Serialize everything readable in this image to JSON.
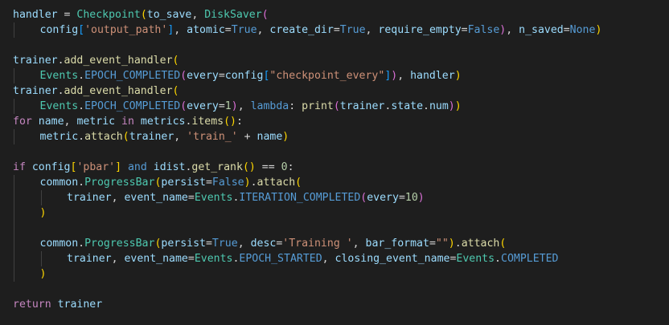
{
  "colors": {
    "background": "#1e1e1e",
    "variable": "#9cdcfe",
    "text": "#d4d4d4",
    "function": "#dcdcaa",
    "class": "#4ec9b0",
    "keyword": "#569cd6",
    "control": "#c586c0",
    "string": "#ce9178",
    "number": "#b5cea8",
    "bracket1": "#ffd700",
    "bracket2": "#da70d6",
    "bracket3": "#179fff",
    "indent_guide": "#404040"
  },
  "code_lines": [
    {
      "indent": 0,
      "tokens": [
        {
          "t": "handler",
          "c": "variable"
        },
        {
          "t": " = ",
          "c": "text"
        },
        {
          "t": "Checkpoint",
          "c": "class"
        },
        {
          "t": "(",
          "c": "bracket1"
        },
        {
          "t": "to_save",
          "c": "variable"
        },
        {
          "t": ", ",
          "c": "text"
        },
        {
          "t": "DiskSaver",
          "c": "class"
        },
        {
          "t": "(",
          "c": "bracket2"
        }
      ]
    },
    {
      "indent": 1,
      "tokens": [
        {
          "t": "config",
          "c": "variable"
        },
        {
          "t": "[",
          "c": "bracket3"
        },
        {
          "t": "'output_path'",
          "c": "string"
        },
        {
          "t": "]",
          "c": "bracket3"
        },
        {
          "t": ", ",
          "c": "text"
        },
        {
          "t": "atomic",
          "c": "variable"
        },
        {
          "t": "=",
          "c": "text"
        },
        {
          "t": "True",
          "c": "keyword"
        },
        {
          "t": ", ",
          "c": "text"
        },
        {
          "t": "create_dir",
          "c": "variable"
        },
        {
          "t": "=",
          "c": "text"
        },
        {
          "t": "True",
          "c": "keyword"
        },
        {
          "t": ", ",
          "c": "text"
        },
        {
          "t": "require_empty",
          "c": "variable"
        },
        {
          "t": "=",
          "c": "text"
        },
        {
          "t": "False",
          "c": "keyword"
        },
        {
          "t": ")",
          "c": "bracket2"
        },
        {
          "t": ", ",
          "c": "text"
        },
        {
          "t": "n_saved",
          "c": "variable"
        },
        {
          "t": "=",
          "c": "text"
        },
        {
          "t": "None",
          "c": "keyword"
        },
        {
          "t": ")",
          "c": "bracket1"
        }
      ]
    },
    {
      "indent": 0,
      "tokens": []
    },
    {
      "indent": 0,
      "tokens": [
        {
          "t": "trainer",
          "c": "variable"
        },
        {
          "t": ".",
          "c": "text"
        },
        {
          "t": "add_event_handler",
          "c": "function"
        },
        {
          "t": "(",
          "c": "bracket1"
        }
      ]
    },
    {
      "indent": 1,
      "tokens": [
        {
          "t": "Events",
          "c": "class"
        },
        {
          "t": ".",
          "c": "text"
        },
        {
          "t": "EPOCH_COMPLETED",
          "c": "keyword"
        },
        {
          "t": "(",
          "c": "bracket2"
        },
        {
          "t": "every",
          "c": "variable"
        },
        {
          "t": "=",
          "c": "text"
        },
        {
          "t": "config",
          "c": "variable"
        },
        {
          "t": "[",
          "c": "bracket3"
        },
        {
          "t": "\"checkpoint_every\"",
          "c": "string"
        },
        {
          "t": "]",
          "c": "bracket3"
        },
        {
          "t": ")",
          "c": "bracket2"
        },
        {
          "t": ", ",
          "c": "text"
        },
        {
          "t": "handler",
          "c": "variable"
        },
        {
          "t": ")",
          "c": "bracket1"
        }
      ]
    },
    {
      "indent": 0,
      "tokens": [
        {
          "t": "trainer",
          "c": "variable"
        },
        {
          "t": ".",
          "c": "text"
        },
        {
          "t": "add_event_handler",
          "c": "function"
        },
        {
          "t": "(",
          "c": "bracket1"
        }
      ]
    },
    {
      "indent": 1,
      "tokens": [
        {
          "t": "Events",
          "c": "class"
        },
        {
          "t": ".",
          "c": "text"
        },
        {
          "t": "EPOCH_COMPLETED",
          "c": "keyword"
        },
        {
          "t": "(",
          "c": "bracket2"
        },
        {
          "t": "every",
          "c": "variable"
        },
        {
          "t": "=",
          "c": "text"
        },
        {
          "t": "1",
          "c": "number"
        },
        {
          "t": ")",
          "c": "bracket2"
        },
        {
          "t": ", ",
          "c": "text"
        },
        {
          "t": "lambda",
          "c": "keyword"
        },
        {
          "t": ": ",
          "c": "text"
        },
        {
          "t": "print",
          "c": "function"
        },
        {
          "t": "(",
          "c": "bracket2"
        },
        {
          "t": "trainer",
          "c": "variable"
        },
        {
          "t": ".",
          "c": "text"
        },
        {
          "t": "state",
          "c": "variable"
        },
        {
          "t": ".",
          "c": "text"
        },
        {
          "t": "num",
          "c": "variable"
        },
        {
          "t": ")",
          "c": "bracket2"
        },
        {
          "t": ")",
          "c": "bracket1"
        }
      ]
    },
    {
      "indent": 0,
      "tokens": [
        {
          "t": "for",
          "c": "control"
        },
        {
          "t": " ",
          "c": "text"
        },
        {
          "t": "name",
          "c": "variable"
        },
        {
          "t": ", ",
          "c": "text"
        },
        {
          "t": "metric",
          "c": "variable"
        },
        {
          "t": " ",
          "c": "text"
        },
        {
          "t": "in",
          "c": "control"
        },
        {
          "t": " ",
          "c": "text"
        },
        {
          "t": "metrics",
          "c": "variable"
        },
        {
          "t": ".",
          "c": "text"
        },
        {
          "t": "items",
          "c": "function"
        },
        {
          "t": "()",
          "c": "bracket1"
        },
        {
          "t": ":",
          "c": "text"
        }
      ]
    },
    {
      "indent": 1,
      "tokens": [
        {
          "t": "metric",
          "c": "variable"
        },
        {
          "t": ".",
          "c": "text"
        },
        {
          "t": "attach",
          "c": "function"
        },
        {
          "t": "(",
          "c": "bracket1"
        },
        {
          "t": "trainer",
          "c": "variable"
        },
        {
          "t": ", ",
          "c": "text"
        },
        {
          "t": "'train_'",
          "c": "string"
        },
        {
          "t": " + ",
          "c": "text"
        },
        {
          "t": "name",
          "c": "variable"
        },
        {
          "t": ")",
          "c": "bracket1"
        }
      ]
    },
    {
      "indent": 0,
      "tokens": []
    },
    {
      "indent": 0,
      "tokens": [
        {
          "t": "if",
          "c": "control"
        },
        {
          "t": " ",
          "c": "text"
        },
        {
          "t": "config",
          "c": "variable"
        },
        {
          "t": "[",
          "c": "bracket1"
        },
        {
          "t": "'pbar'",
          "c": "string"
        },
        {
          "t": "]",
          "c": "bracket1"
        },
        {
          "t": " ",
          "c": "text"
        },
        {
          "t": "and",
          "c": "keyword"
        },
        {
          "t": " ",
          "c": "text"
        },
        {
          "t": "idist",
          "c": "variable"
        },
        {
          "t": ".",
          "c": "text"
        },
        {
          "t": "get_rank",
          "c": "function"
        },
        {
          "t": "()",
          "c": "bracket1"
        },
        {
          "t": " == ",
          "c": "text"
        },
        {
          "t": "0",
          "c": "number"
        },
        {
          "t": ":",
          "c": "text"
        }
      ]
    },
    {
      "indent": 1,
      "tokens": [
        {
          "t": "common",
          "c": "variable"
        },
        {
          "t": ".",
          "c": "text"
        },
        {
          "t": "ProgressBar",
          "c": "class"
        },
        {
          "t": "(",
          "c": "bracket1"
        },
        {
          "t": "persist",
          "c": "variable"
        },
        {
          "t": "=",
          "c": "text"
        },
        {
          "t": "False",
          "c": "keyword"
        },
        {
          "t": ")",
          "c": "bracket1"
        },
        {
          "t": ".",
          "c": "text"
        },
        {
          "t": "attach",
          "c": "function"
        },
        {
          "t": "(",
          "c": "bracket1"
        }
      ]
    },
    {
      "indent": 2,
      "tokens": [
        {
          "t": "trainer",
          "c": "variable"
        },
        {
          "t": ", ",
          "c": "text"
        },
        {
          "t": "event_name",
          "c": "variable"
        },
        {
          "t": "=",
          "c": "text"
        },
        {
          "t": "Events",
          "c": "class"
        },
        {
          "t": ".",
          "c": "text"
        },
        {
          "t": "ITERATION_COMPLETED",
          "c": "keyword"
        },
        {
          "t": "(",
          "c": "bracket2"
        },
        {
          "t": "every",
          "c": "variable"
        },
        {
          "t": "=",
          "c": "text"
        },
        {
          "t": "10",
          "c": "number"
        },
        {
          "t": ")",
          "c": "bracket2"
        }
      ]
    },
    {
      "indent": 1,
      "tokens": [
        {
          "t": ")",
          "c": "bracket1"
        }
      ]
    },
    {
      "indent": 0,
      "tokens": []
    },
    {
      "indent": 1,
      "tokens": [
        {
          "t": "common",
          "c": "variable"
        },
        {
          "t": ".",
          "c": "text"
        },
        {
          "t": "ProgressBar",
          "c": "class"
        },
        {
          "t": "(",
          "c": "bracket1"
        },
        {
          "t": "persist",
          "c": "variable"
        },
        {
          "t": "=",
          "c": "text"
        },
        {
          "t": "True",
          "c": "keyword"
        },
        {
          "t": ", ",
          "c": "text"
        },
        {
          "t": "desc",
          "c": "variable"
        },
        {
          "t": "=",
          "c": "text"
        },
        {
          "t": "'Training '",
          "c": "string"
        },
        {
          "t": ", ",
          "c": "text"
        },
        {
          "t": "bar_format",
          "c": "variable"
        },
        {
          "t": "=",
          "c": "text"
        },
        {
          "t": "\"\"",
          "c": "string"
        },
        {
          "t": ")",
          "c": "bracket1"
        },
        {
          "t": ".",
          "c": "text"
        },
        {
          "t": "attach",
          "c": "function"
        },
        {
          "t": "(",
          "c": "bracket1"
        }
      ]
    },
    {
      "indent": 2,
      "tokens": [
        {
          "t": "trainer",
          "c": "variable"
        },
        {
          "t": ", ",
          "c": "text"
        },
        {
          "t": "event_name",
          "c": "variable"
        },
        {
          "t": "=",
          "c": "text"
        },
        {
          "t": "Events",
          "c": "class"
        },
        {
          "t": ".",
          "c": "text"
        },
        {
          "t": "EPOCH_STARTED",
          "c": "keyword"
        },
        {
          "t": ", ",
          "c": "text"
        },
        {
          "t": "closing_event_name",
          "c": "variable"
        },
        {
          "t": "=",
          "c": "text"
        },
        {
          "t": "Events",
          "c": "class"
        },
        {
          "t": ".",
          "c": "text"
        },
        {
          "t": "COMPLETED",
          "c": "keyword"
        }
      ]
    },
    {
      "indent": 1,
      "tokens": [
        {
          "t": ")",
          "c": "bracket1"
        }
      ]
    },
    {
      "indent": 0,
      "tokens": []
    },
    {
      "indent": 0,
      "tokens": [
        {
          "t": "return",
          "c": "control"
        },
        {
          "t": " ",
          "c": "text"
        },
        {
          "t": "trainer",
          "c": "variable"
        }
      ]
    }
  ]
}
